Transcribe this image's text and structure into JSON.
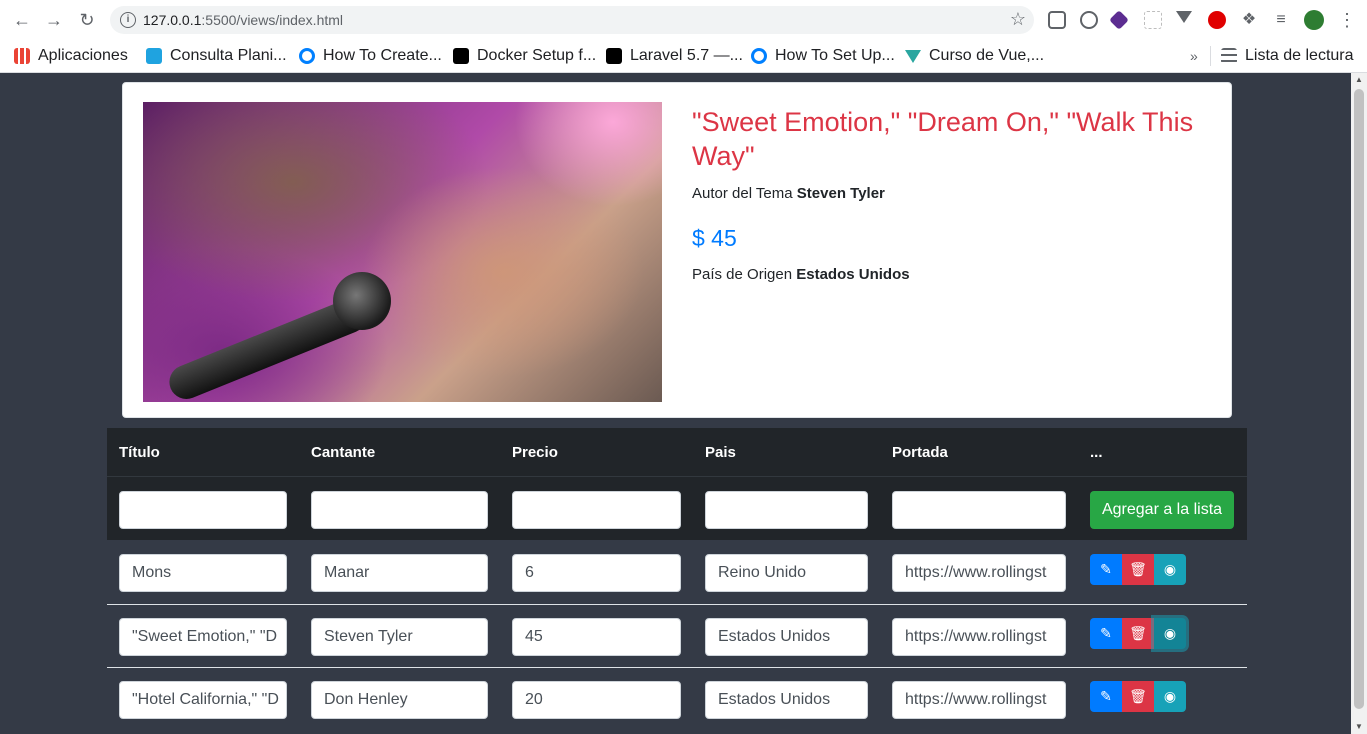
{
  "browser": {
    "url_host": "127.0.0.1",
    "url_rest": ":5500/views/index.html",
    "bookmarks": [
      {
        "label": "Aplicaciones",
        "color": "#ea4335"
      },
      {
        "label": "Consulta Plani...",
        "color": "#1fa3e0"
      },
      {
        "label": "How To Create...",
        "color": "#0080ff"
      },
      {
        "label": "Docker Setup f...",
        "color": "#000000"
      },
      {
        "label": "Laravel 5.7 —...",
        "color": "#000000"
      },
      {
        "label": "How To Set Up...",
        "color": "#0080ff"
      },
      {
        "label": "Curso de Vue,...",
        "color": "#2aa6a0"
      }
    ],
    "more": "»",
    "reading_list": "Lista de lectura"
  },
  "card": {
    "title": "\"Sweet Emotion,\" \"Dream On,\" \"Walk This Way\"",
    "author_label": "Autor del Tema",
    "author": "Steven Tyler",
    "price": "$ 45",
    "country_label": "País de Origen",
    "country": "Estados Unidos"
  },
  "table": {
    "headers": [
      "Título",
      "Cantante",
      "Precio",
      "Pais",
      "Portada",
      "..."
    ],
    "add_button": "Agregar a la lista",
    "rows": [
      {
        "titulo": "Mons",
        "cantante": "Manar",
        "precio": "6",
        "pais": "Reino Unido",
        "portada": "https://www.rollingst"
      },
      {
        "titulo": "\"Sweet Emotion,\" \"D",
        "cantante": "Steven Tyler",
        "precio": "45",
        "pais": "Estados Unidos",
        "portada": "https://www.rollingst"
      },
      {
        "titulo": "\"Hotel California,\" \"D",
        "cantante": "Don Henley",
        "precio": "20",
        "pais": "Estados Unidos",
        "portada": "https://www.rollingst"
      }
    ]
  },
  "colors": {
    "title": "#dc3545",
    "price": "#007bff",
    "add": "#28a745",
    "edit": "#007bff",
    "delete": "#dc3545",
    "view": "#17a2b8"
  }
}
